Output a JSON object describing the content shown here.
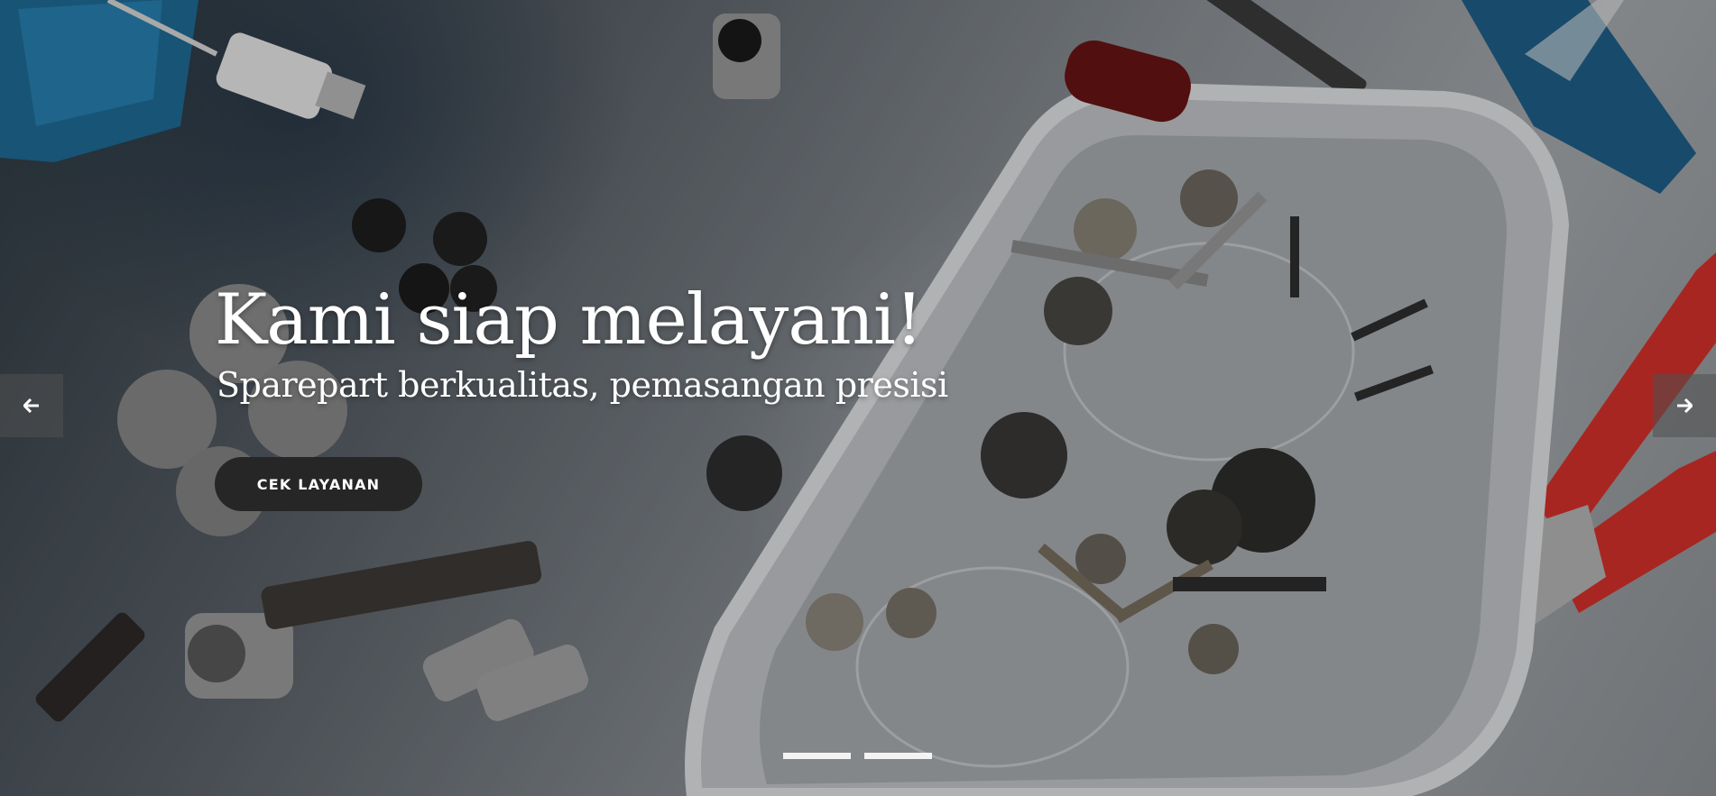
{
  "slider": {
    "title": "Kami siap melayani!",
    "subtitle": "Sparepart berkualitas, pemasangan presisi",
    "cta_label": "CEK LAYANAN",
    "prev_icon": "arrow-left-icon",
    "next_icon": "arrow-right-icon",
    "indicators": 2
  },
  "colors": {
    "button_bg": "#262626",
    "text": "#ffffff"
  }
}
